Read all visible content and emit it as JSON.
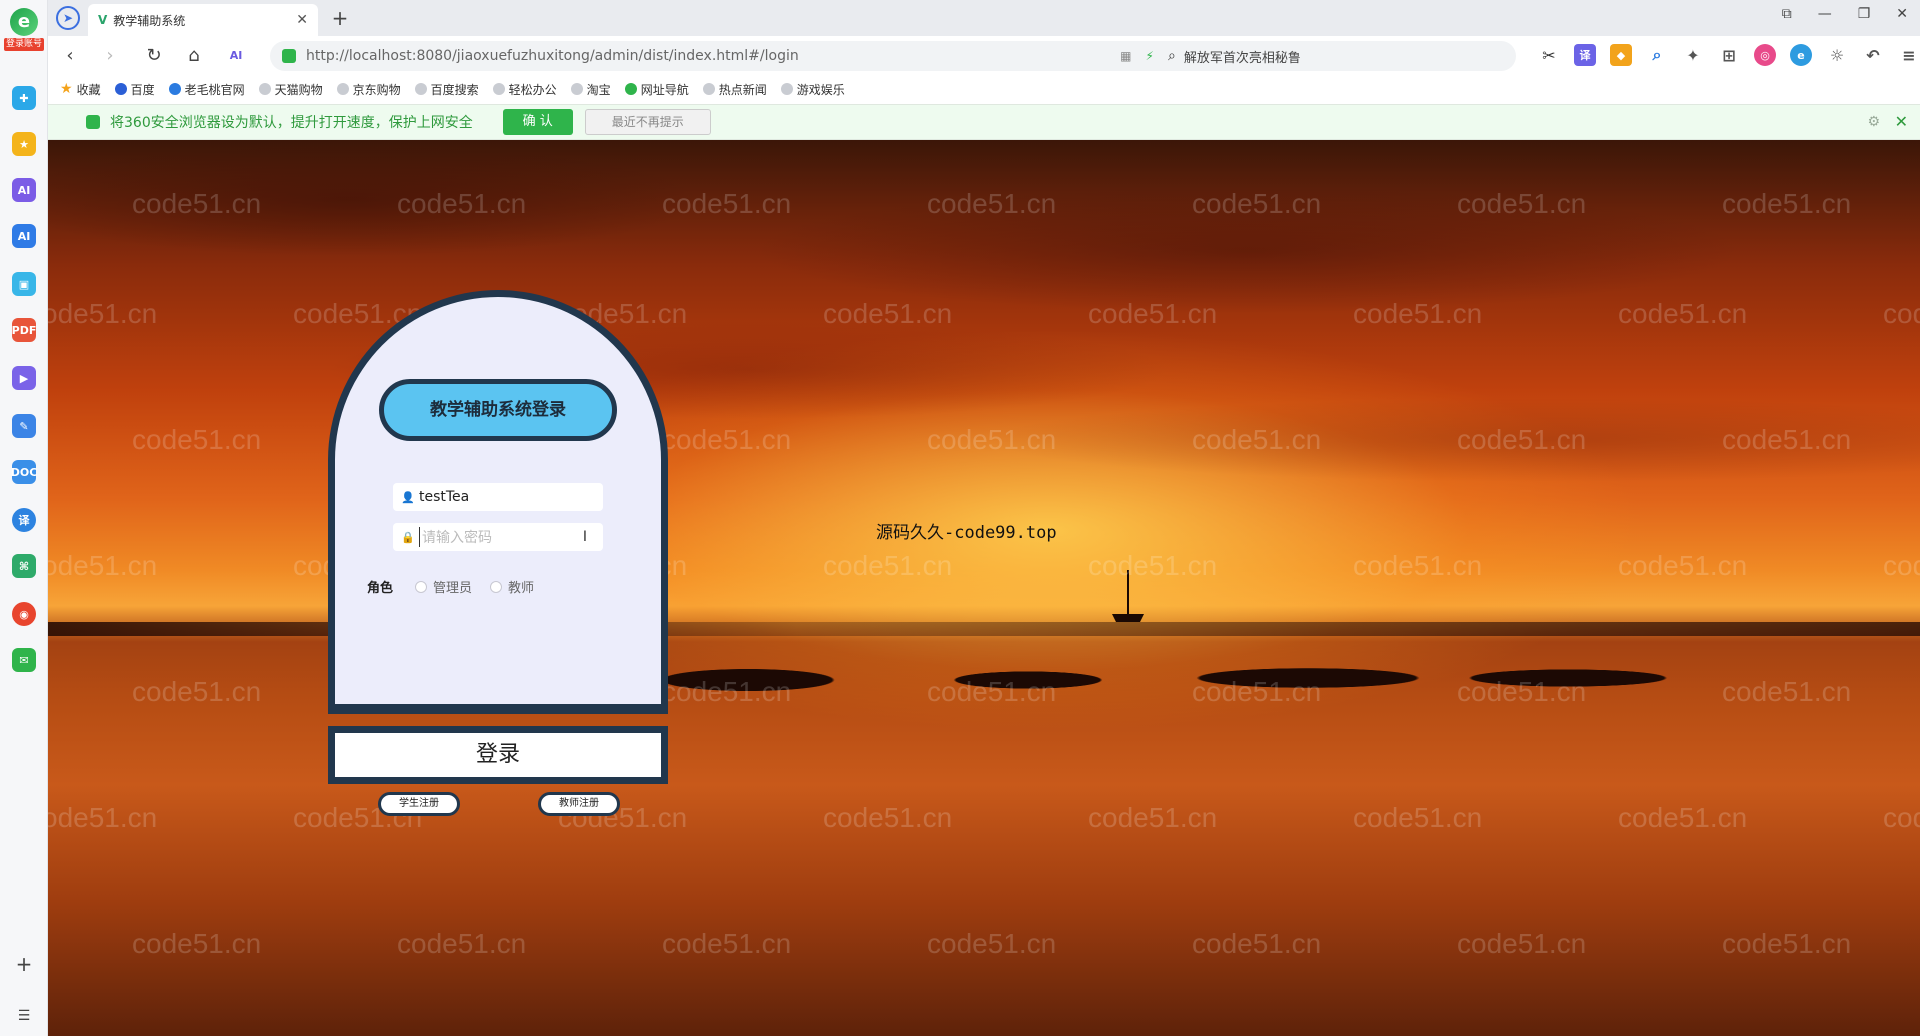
{
  "browser": {
    "tab_title": "教学辅助系统",
    "address_url": "http://localhost:8080/jiaoxuefuzhuxitong/admin/dist/index.html#/login",
    "search_text": "解放军首次亮相秘鲁",
    "sidebar_badge": "登录账号",
    "bookmarks": [
      "收藏",
      "百度",
      "老毛桃官网",
      "天猫购物",
      "京东购物",
      "百度搜索",
      "轻松办公",
      "淘宝",
      "网址导航",
      "热点新闻",
      "游戏娱乐"
    ],
    "infobar_text": "将360安全浏览器设为默认，提升打开速度，保护上网安全",
    "infobar_confirm": "确 认",
    "infobar_later": "最近不再提示",
    "window_controls": [
      "⧉",
      "—",
      "❐",
      "✕"
    ]
  },
  "page": {
    "watermark": "code51.cn",
    "center_note": "源码久久-code99.top"
  },
  "login": {
    "title": "教学辅助系统登录",
    "username_value": "testTea",
    "password_placeholder": "请输入密码",
    "role_label": "角色",
    "roles": [
      "管理员",
      "教师"
    ],
    "submit_label": "登录",
    "student_register": "学生注册",
    "teacher_register": "教师注册"
  },
  "colors": {
    "card_border": "#21374d",
    "title_fill": "#5bc4f1",
    "card_fill": "#ecedfb",
    "confirm_green": "#2fb44b"
  }
}
